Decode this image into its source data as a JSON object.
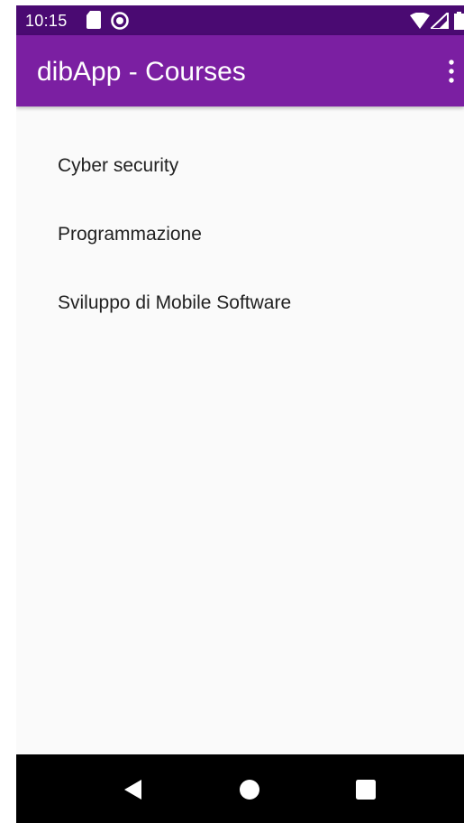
{
  "status_bar": {
    "time": "10:15",
    "icons": [
      "sd-card-icon",
      "dnd-icon",
      "wifi-icon",
      "signal-icon",
      "battery-icon"
    ]
  },
  "app_bar": {
    "title": "dibApp - Courses",
    "menu_icon": "more-vert-icon",
    "color": "#7b1fa2",
    "status_color": "#4a0a72"
  },
  "courses": [
    {
      "label": "Cyber security"
    },
    {
      "label": "Programmazione"
    },
    {
      "label": "Sviluppo di Mobile Software"
    }
  ],
  "nav_bar": {
    "buttons": [
      "back-icon",
      "home-icon",
      "recents-icon"
    ]
  }
}
